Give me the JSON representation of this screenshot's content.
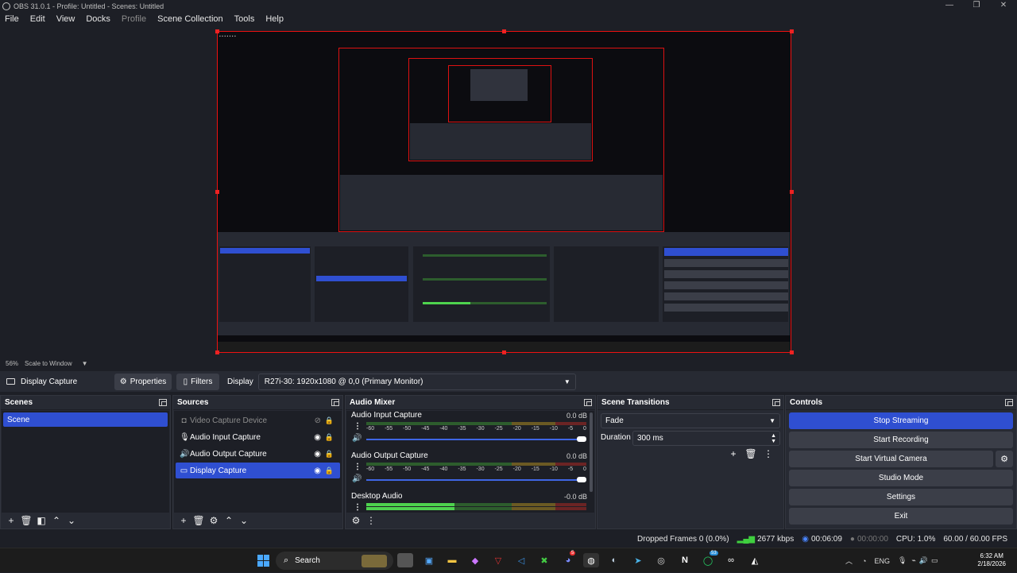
{
  "window": {
    "title": "OBS 31.0.1 - Profile: Untitled - Scenes: Untitled",
    "controls": [
      "—",
      "❐",
      "✕"
    ]
  },
  "menu": {
    "items": [
      "File",
      "Edit",
      "View",
      "Docks",
      "Profile",
      "Scene Collection",
      "Tools",
      "Help"
    ]
  },
  "preview": {
    "zoom": "56%",
    "scale_mode": "Scale to Window"
  },
  "source_toolbar": {
    "source_name": "Display Capture",
    "properties_label": "Properties",
    "filters_label": "Filters",
    "display_label": "Display",
    "display_value": "R27i-30: 1920x1080 @ 0,0 (Primary Monitor)"
  },
  "scenes": {
    "title": "Scenes",
    "items": [
      "Scene"
    ]
  },
  "sources": {
    "title": "Sources",
    "items": [
      {
        "label": "Video Capture Device",
        "icon": "camera-icon"
      },
      {
        "label": "Audio Input Capture",
        "icon": "microphone-icon"
      },
      {
        "label": "Audio Output Capture",
        "icon": "speaker-icon"
      },
      {
        "label": "Display Capture",
        "icon": "monitor-icon"
      }
    ]
  },
  "mixer": {
    "title": "Audio Mixer",
    "ticks": [
      "-60",
      "-55",
      "-50",
      "-45",
      "-40",
      "-35",
      "-30",
      "-25",
      "-20",
      "-15",
      "-10",
      "-5",
      "0"
    ],
    "channels": [
      {
        "name": "Audio Input Capture",
        "db": "0.0 dB",
        "volume": 1.0
      },
      {
        "name": "Audio Output Capture",
        "db": "0.0 dB",
        "volume": 1.0
      },
      {
        "name": "Desktop Audio",
        "db": "-0.0 dB",
        "volume": 1.0
      }
    ]
  },
  "transitions": {
    "title": "Scene Transitions",
    "selected": "Fade",
    "duration_label": "Duration",
    "duration_value": "300 ms"
  },
  "controls": {
    "title": "Controls",
    "stop_streaming": "Stop Streaming",
    "start_recording": "Start Recording",
    "start_virtual_camera": "Start Virtual Camera",
    "studio_mode": "Studio Mode",
    "settings": "Settings",
    "exit": "Exit"
  },
  "status": {
    "dropped_frames": "Dropped Frames 0 (0.0%)",
    "bitrate": "2677 kbps",
    "stream_time": "00:06:09",
    "record_time": "00:00:00",
    "cpu": "CPU: 1.0%",
    "fps": "60.00 / 60.00 FPS"
  },
  "taskbar": {
    "search_label": "Search",
    "language": "ENG",
    "time": "6:32 AM",
    "date": "2/18/2026",
    "badges": {
      "discord": "5",
      "whatsapp": "53"
    }
  },
  "colors": {
    "accent": "#2f4fd1",
    "panel": "#272a33",
    "background": "#1d1f26",
    "selection_border": "#e11111"
  }
}
